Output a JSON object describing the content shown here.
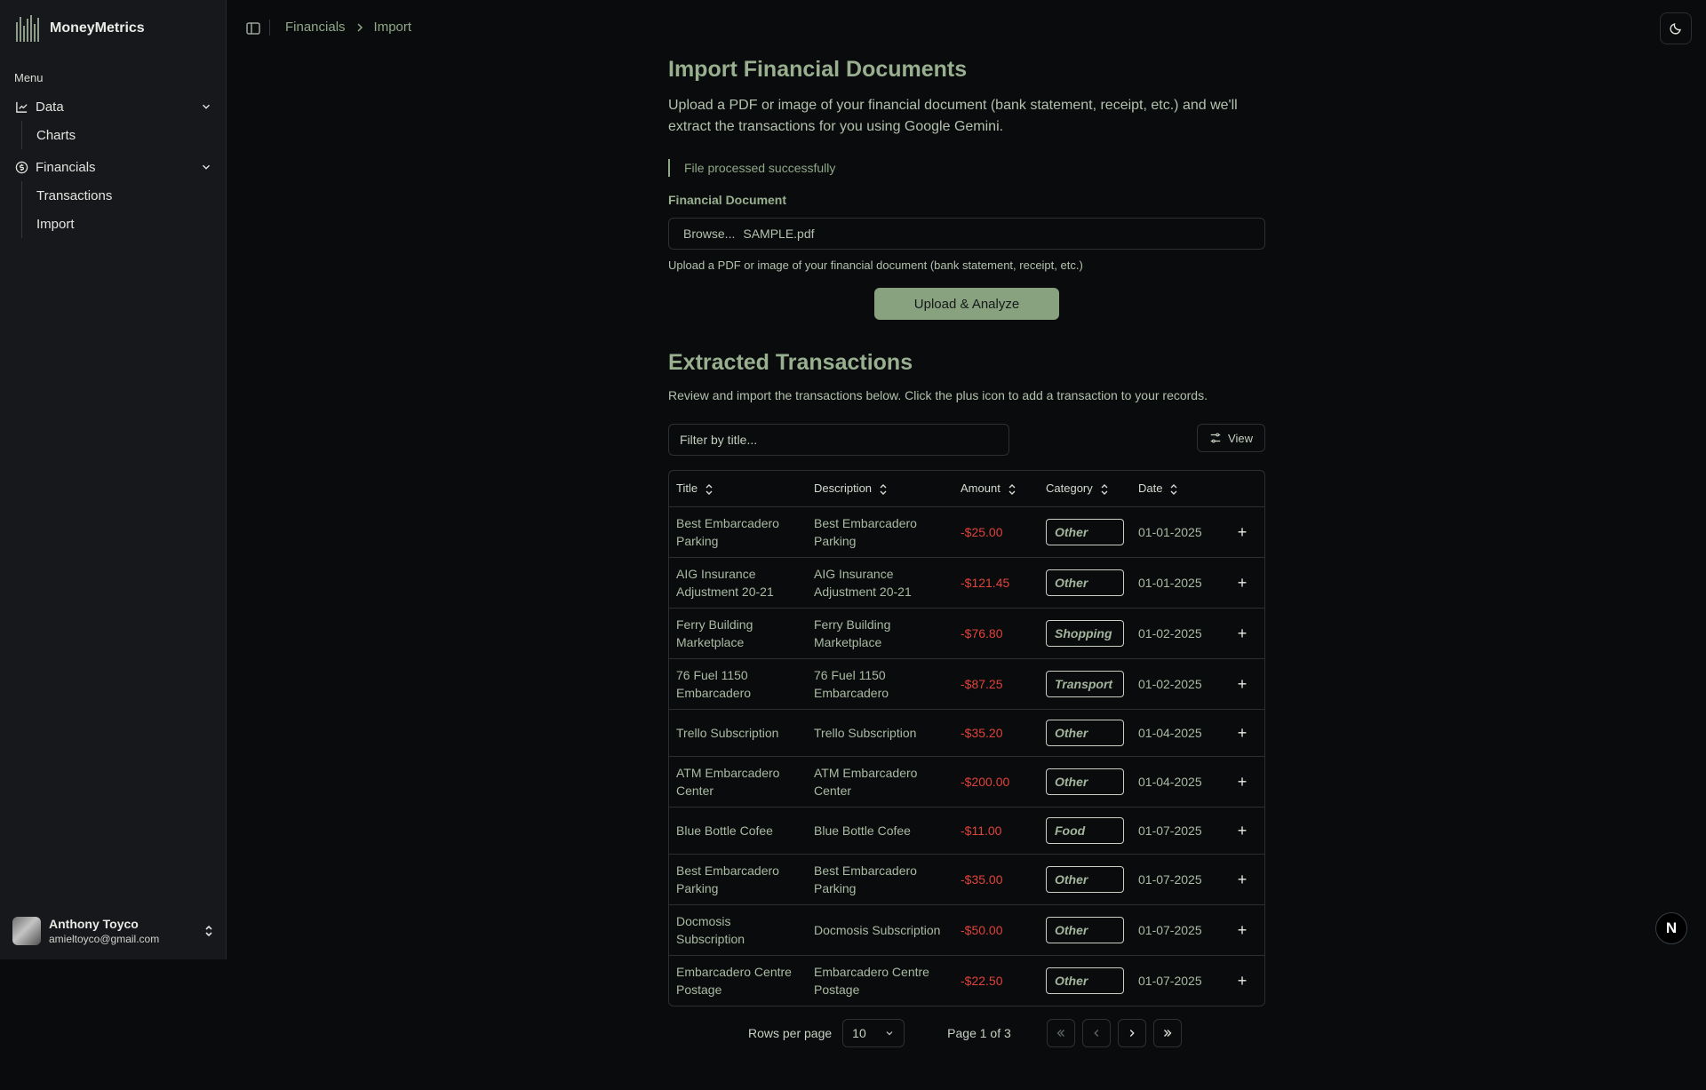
{
  "app": {
    "name": "MoneyMetrics"
  },
  "sidebar": {
    "menu_label": "Menu",
    "groups": [
      {
        "label": "Data",
        "icon": "chart-icon",
        "items": [
          {
            "label": "Charts"
          }
        ]
      },
      {
        "label": "Financials",
        "icon": "dollar-circle-icon",
        "items": [
          {
            "label": "Transactions"
          },
          {
            "label": "Import"
          }
        ]
      }
    ],
    "user": {
      "name": "Anthony Toyco",
      "email": "amieltoyco@gmail.com"
    }
  },
  "breadcrumb": {
    "parent": "Financials",
    "current": "Import"
  },
  "import": {
    "title": "Import Financial Documents",
    "description": "Upload a PDF or image of your financial document (bank statement, receipt, etc.) and we'll extract the transactions for you using Google Gemini.",
    "status": "File processed successfully",
    "field_label": "Financial Document",
    "browse_label": "Browse...",
    "file_name": "SAMPLE.pdf",
    "helper": "Upload a PDF or image of your financial document (bank statement, receipt, etc.)",
    "upload_button": "Upload & Analyze"
  },
  "extracted": {
    "title": "Extracted Transactions",
    "description": "Review and import the transactions below. Click the plus icon to add a transaction to your records.",
    "filter_placeholder": "Filter by title...",
    "view_button": "View",
    "columns": [
      "Title",
      "Description",
      "Amount",
      "Category",
      "Date"
    ],
    "rows": [
      {
        "title": "Best Embarcadero Parking",
        "description": "Best Embarcadero Parking",
        "amount": "-$25.00",
        "category": "Other",
        "date": "01-01-2025"
      },
      {
        "title": "AIG Insurance Adjustment 20-21",
        "description": "AIG Insurance Adjustment 20-21",
        "amount": "-$121.45",
        "category": "Other",
        "date": "01-01-2025"
      },
      {
        "title": "Ferry Building Marketplace",
        "description": "Ferry Building Marketplace",
        "amount": "-$76.80",
        "category": "Shopping",
        "date": "01-02-2025"
      },
      {
        "title": "76 Fuel 1150 Embarcadero",
        "description": "76 Fuel 1150 Embarcadero",
        "amount": "-$87.25",
        "category": "Transport",
        "date": "01-02-2025"
      },
      {
        "title": "Trello Subscription",
        "description": "Trello Subscription",
        "amount": "-$35.20",
        "category": "Other",
        "date": "01-04-2025"
      },
      {
        "title": "ATM Embarcadero Center",
        "description": "ATM Embarcadero Center",
        "amount": "-$200.00",
        "category": "Other",
        "date": "01-04-2025"
      },
      {
        "title": "Blue Bottle Cofee",
        "description": "Blue Bottle Cofee",
        "amount": "-$11.00",
        "category": "Food",
        "date": "01-07-2025"
      },
      {
        "title": "Best Embarcadero Parking",
        "description": "Best Embarcadero Parking",
        "amount": "-$35.00",
        "category": "Other",
        "date": "01-07-2025"
      },
      {
        "title": "Docmosis Subscription",
        "description": "Docmosis Subscription",
        "amount": "-$50.00",
        "category": "Other",
        "date": "01-07-2025"
      },
      {
        "title": "Embarcadero Centre Postage",
        "description": "Embarcadero Centre Postage",
        "amount": "-$22.50",
        "category": "Other",
        "date": "01-07-2025"
      }
    ]
  },
  "pagination": {
    "rows_per_page_label": "Rows per page",
    "rows_per_page": "10",
    "page_info": "Page 1 of 3"
  },
  "fab_label": "N",
  "colors": {
    "accent": "#88a27f",
    "text": "#8fa888",
    "negative": "#e0433a",
    "background": "#0a0b0c",
    "sidebar": "#16181b"
  }
}
